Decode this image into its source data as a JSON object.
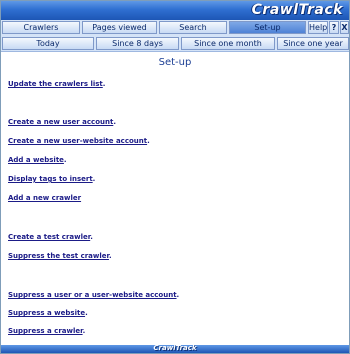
{
  "header": {
    "logo": "CrawlTrack"
  },
  "nav": {
    "crawlers": "Crawlers",
    "pages_viewed": "Pages viewed",
    "search": "Search",
    "setup": "Set-up",
    "help": "Help",
    "question": "?",
    "close": "X"
  },
  "periods": {
    "today": "Today",
    "since_8_days": "Since 8 days",
    "since_one_month": "Since one month",
    "since_one_year": "Since one year"
  },
  "main": {
    "title": "Set-up",
    "links": [
      "Update the crawlers list",
      "Create a new user account",
      "Create a new user-website account",
      "Add a website",
      "Display tags to insert",
      "Add a new crawler",
      "Create a test crawler",
      "Suppress the test crawler",
      "Suppress a user or a user-website account",
      "Suppress a website",
      "Suppress a crawler"
    ],
    "period": "."
  },
  "footer": {
    "logo": "CrawlTrack"
  }
}
